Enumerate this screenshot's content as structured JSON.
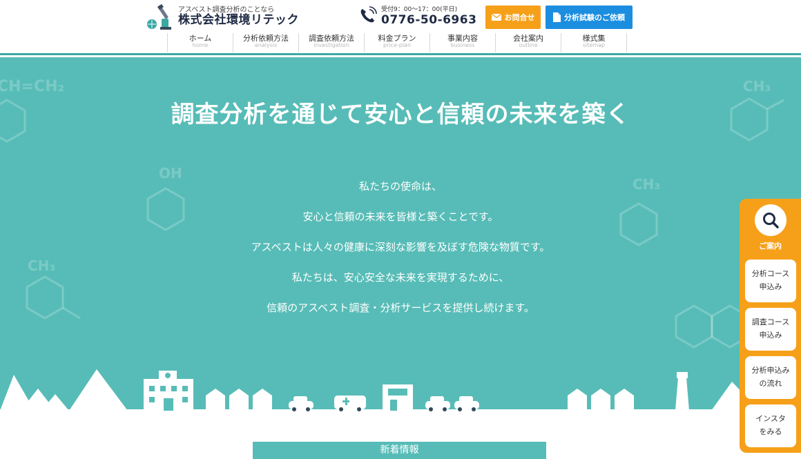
{
  "header": {
    "logo_tagline": "アスベスト調査分析のことなら",
    "logo_name": "株式会社環境リテック",
    "phone_hours": "受付9：00～17：00(平日)",
    "phone_number": "0776-50-6963",
    "contact_button": "お問合せ",
    "request_button": "分析試験のご依頼"
  },
  "nav": [
    {
      "ja": "ホーム",
      "en": "home"
    },
    {
      "ja": "分析依頼方法",
      "en": "analysis"
    },
    {
      "ja": "調査依頼方法",
      "en": "investigation"
    },
    {
      "ja": "料金プラン",
      "en": "price-plan"
    },
    {
      "ja": "事業内容",
      "en": "business"
    },
    {
      "ja": "会社案内",
      "en": "outline"
    },
    {
      "ja": "様式集",
      "en": "sitemap"
    }
  ],
  "hero": {
    "title": "調査分析を通じて安心と信頼の未来を築く",
    "mission": [
      "私たちの使命は、",
      "安心と信頼の未来を皆様と築くことです。",
      "アスベストは人々の健康に深刻な影響を及ぼす危険な物質です。",
      "私たちは、安心安全な未来を実現するために、",
      "信頼のアスベスト調査・分析サービスを提供し続けます。"
    ],
    "decor": {
      "ch_eq": "CH=CH₂",
      "oh": "OH",
      "ch3": "CH₃"
    }
  },
  "news": {
    "title": "新着情報"
  },
  "side_panel": {
    "title": "ご案内",
    "buttons": [
      {
        "line1": "分析コース",
        "line2": "申込み"
      },
      {
        "line1": "調査コース",
        "line2": "申込み"
      },
      {
        "line1": "分析申込み",
        "line2": "の流れ"
      },
      {
        "line1": "インスタ",
        "line2": "をみる"
      }
    ]
  },
  "colors": {
    "teal": "#57bcb7",
    "orange": "#f6a01a",
    "blue": "#1b8ee0",
    "navy": "#1f2a44"
  }
}
